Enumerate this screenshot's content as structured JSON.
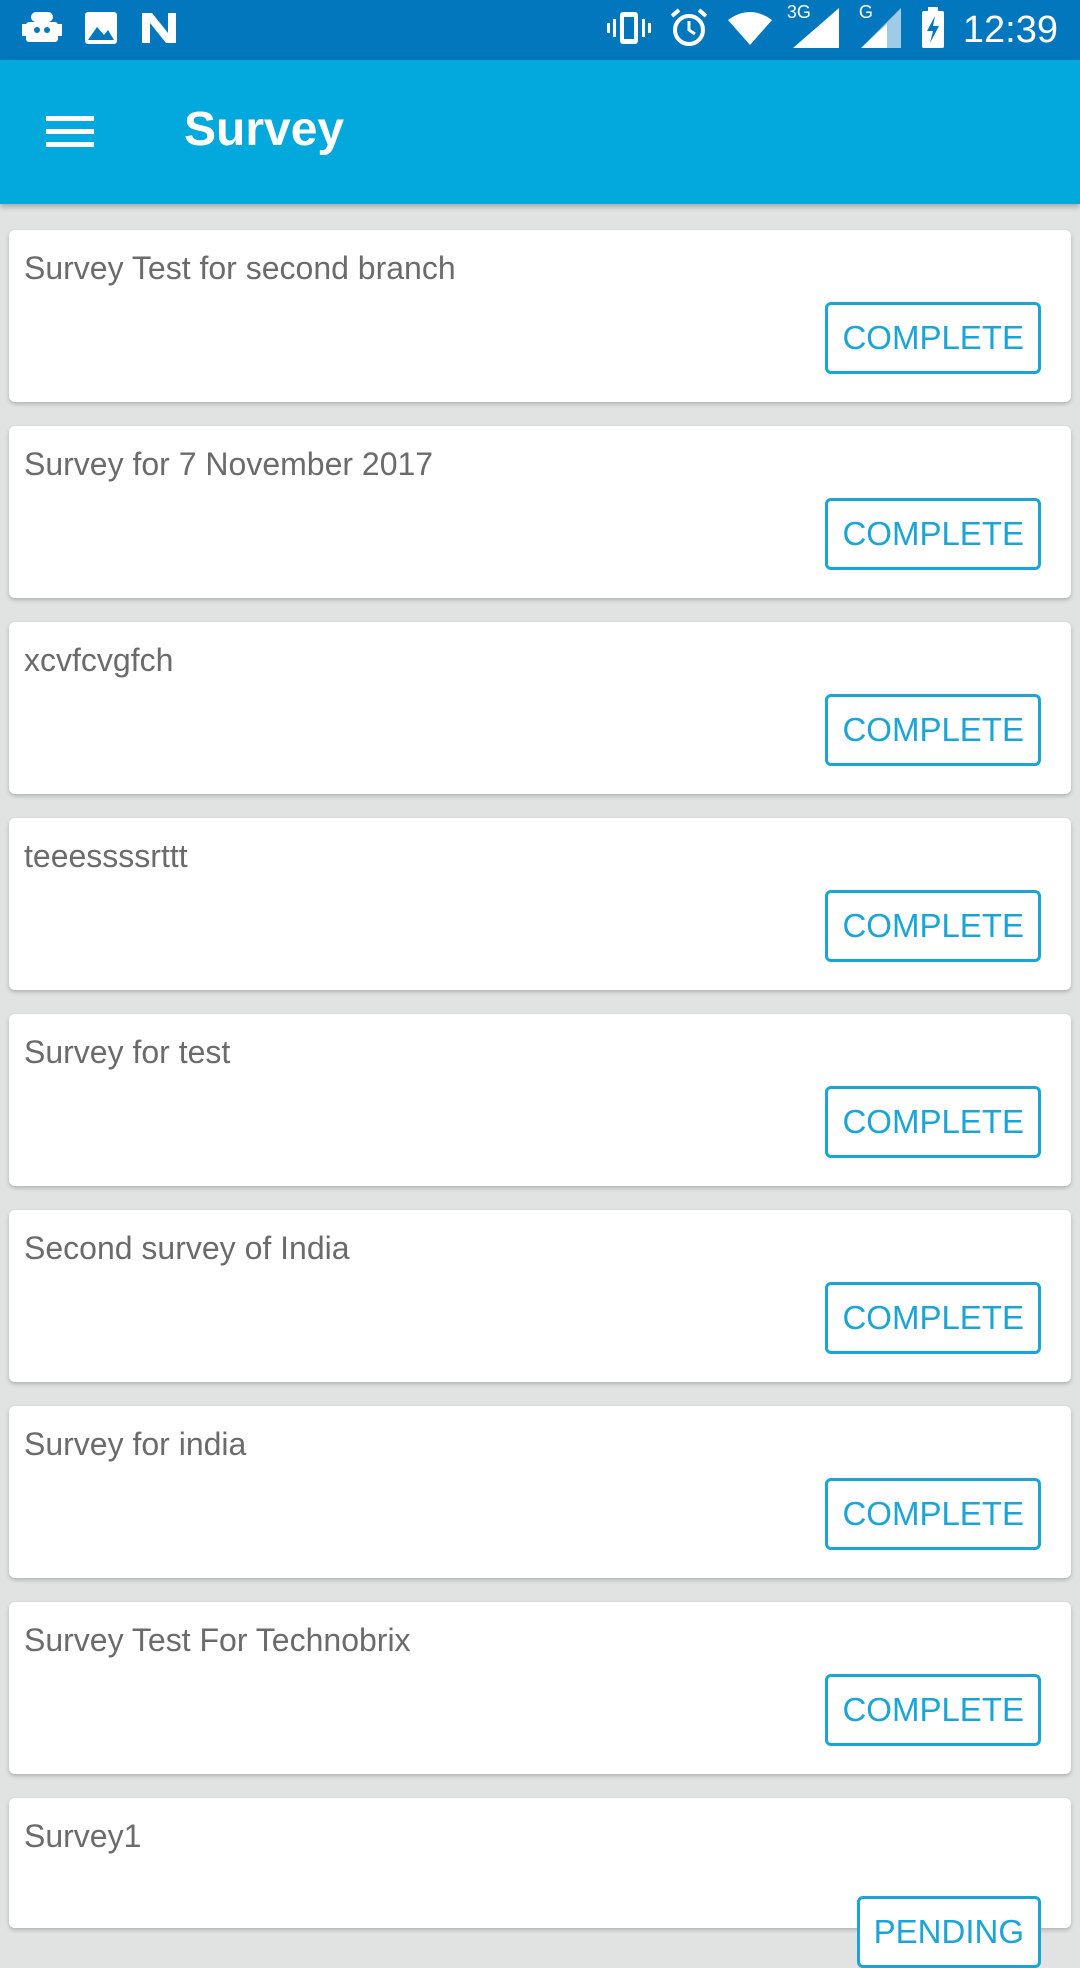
{
  "status_bar": {
    "time": "12:39",
    "network_3g": "3G",
    "network_g": "G",
    "left_icons": [
      "android-robot-icon",
      "image-icon",
      "n-logo-icon"
    ],
    "right_icons": [
      "vibrate-icon",
      "alarm-icon",
      "wifi-icon",
      "signal-3g-icon",
      "signal-g-icon",
      "battery-charging-icon"
    ]
  },
  "app_bar": {
    "title": "Survey",
    "menu_icon": "hamburger-menu-icon"
  },
  "colors": {
    "status_bar": "#0277bd",
    "app_bar": "#03a9dc",
    "accent": "#1aa5d6",
    "background": "#e1e3e3",
    "text": "#6b6b6b"
  },
  "surveys": [
    {
      "title": "Survey Test for second branch",
      "status": "COMPLETE"
    },
    {
      "title": "Survey for 7 November 2017",
      "status": "COMPLETE"
    },
    {
      "title": "xcvfcvgfch",
      "status": "COMPLETE"
    },
    {
      "title": "teeessssrttt",
      "status": "COMPLETE"
    },
    {
      "title": "Survey for test",
      "status": "COMPLETE"
    },
    {
      "title": "Second survey of India",
      "status": "COMPLETE"
    },
    {
      "title": "Survey for india",
      "status": "COMPLETE"
    },
    {
      "title": "Survey Test For Technobrix",
      "status": "COMPLETE"
    },
    {
      "title": "Survey1",
      "status": "PENDING"
    }
  ]
}
